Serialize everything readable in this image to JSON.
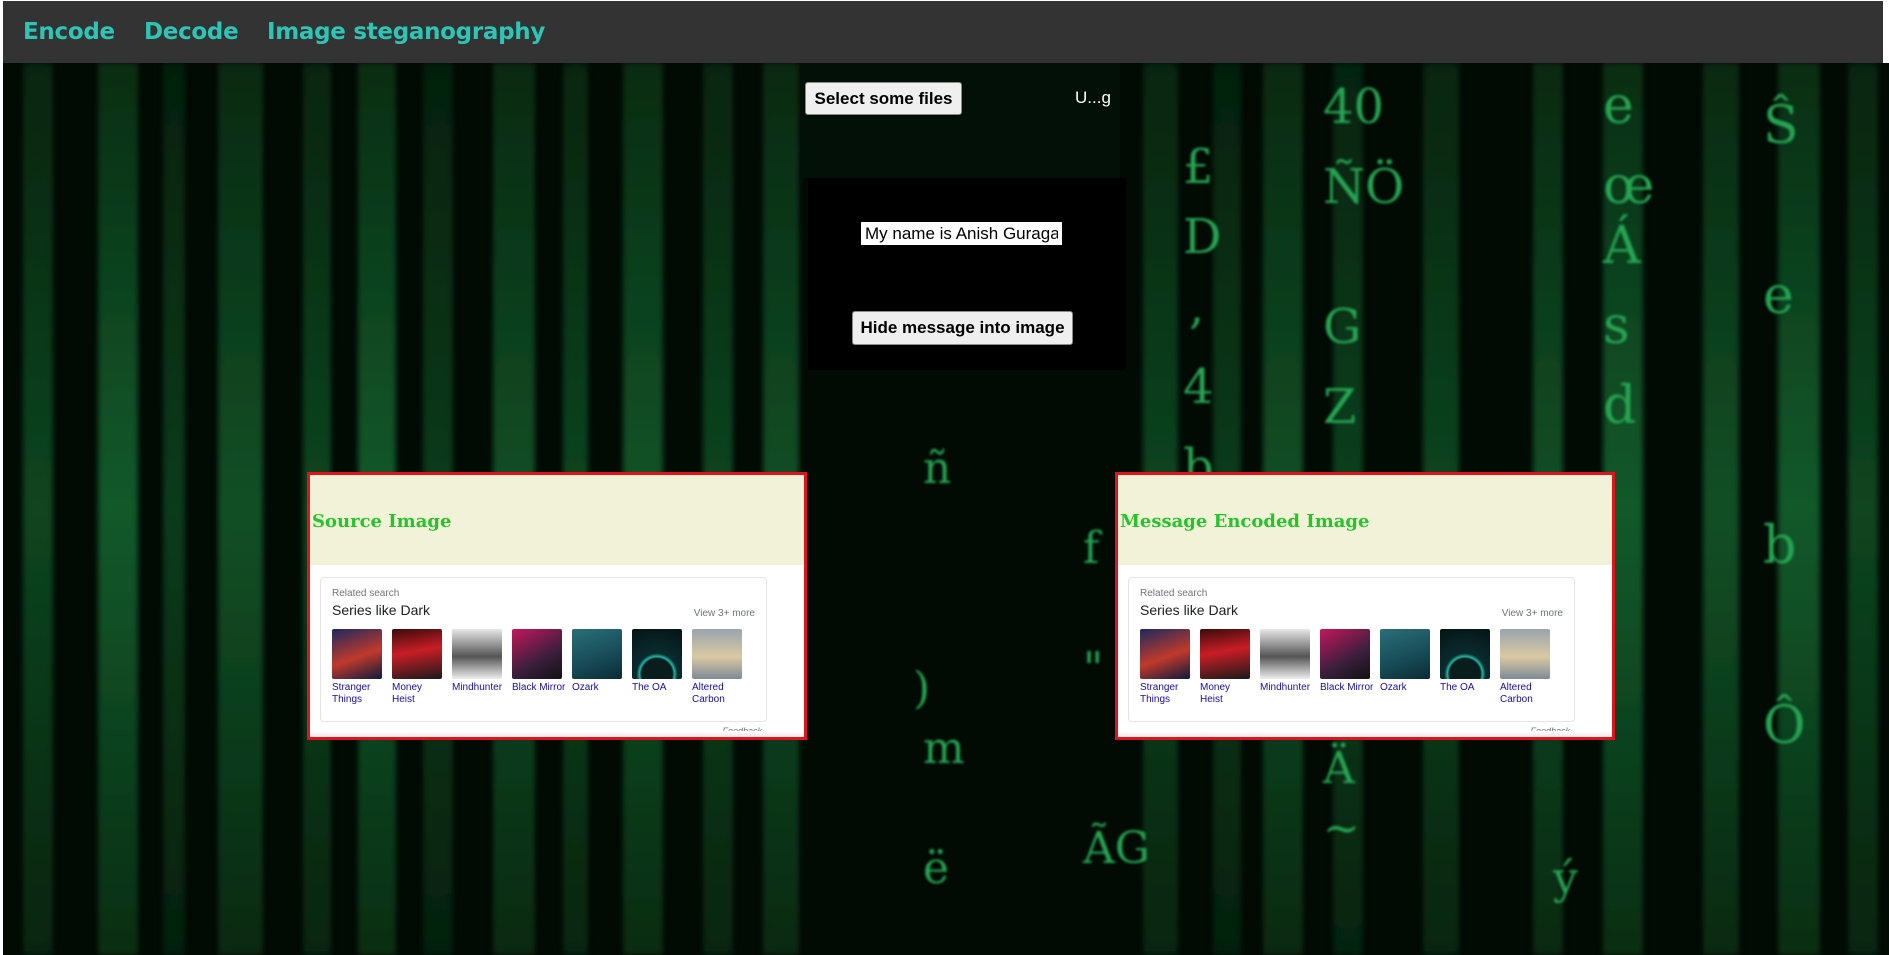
{
  "nav": {
    "links": [
      "Encode",
      "Decode",
      "Image steganography"
    ],
    "accent": "#2ec4b6",
    "background": "#333333"
  },
  "encoder": {
    "select_files_label": "Select some files",
    "file_name": "U...g",
    "message_value": "My name is Anish Guragai",
    "hide_button_label": "Hide message into image"
  },
  "cards": [
    {
      "title": "Source Image",
      "screenshot": {
        "related": "Related search",
        "heading": "Series like Dark",
        "view_more": "View 3+ more",
        "items": [
          "Stranger Things",
          "Money Heist",
          "Mindhunter",
          "Black Mirror",
          "Ozark",
          "The OA",
          "Altered Carbon"
        ],
        "feedback": "Feedback"
      }
    },
    {
      "title": "Message Encoded Image",
      "screenshot": {
        "related": "Related search",
        "heading": "Series like Dark",
        "view_more": "View 3+ more",
        "items": [
          "Stranger Things",
          "Money Heist",
          "Mindhunter",
          "Black Mirror",
          "Ozark",
          "The OA",
          "Altered Carbon"
        ],
        "feedback": "Feedback"
      }
    }
  ],
  "colors": {
    "card_border": "#e0141a",
    "card_title": "#25c42a",
    "matrix_green": "#1f8f45"
  },
  "background_icon": "matrix-code-rain"
}
